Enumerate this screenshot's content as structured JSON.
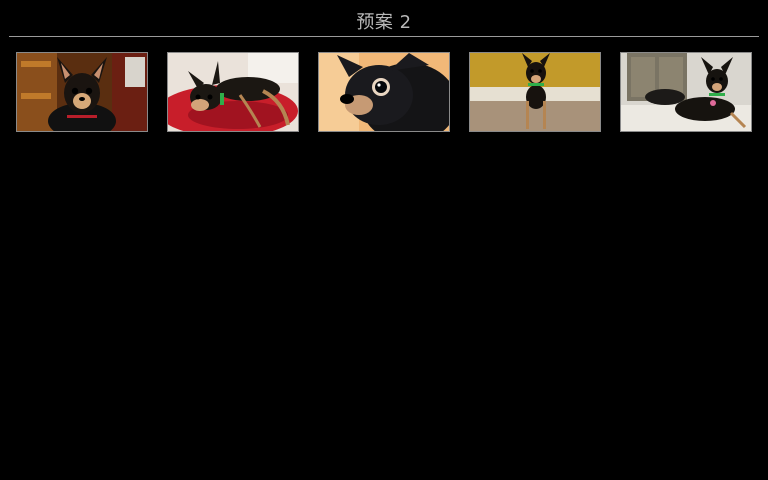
{
  "header": {
    "title": "预案 2"
  },
  "thumbnails": [
    {
      "label": "photo-1",
      "subject": "dog-photo-icon"
    },
    {
      "label": "photo-2",
      "subject": "dog-photo-icon"
    },
    {
      "label": "photo-3",
      "subject": "dog-photo-icon"
    },
    {
      "label": "photo-4",
      "subject": "dog-photo-icon"
    },
    {
      "label": "photo-5",
      "subject": "dog-photo-icon"
    }
  ]
}
